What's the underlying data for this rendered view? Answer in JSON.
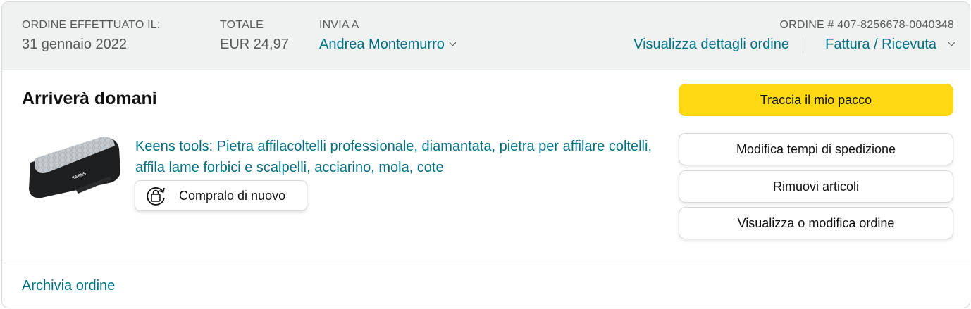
{
  "header": {
    "order_placed_label": "ORDINE EFFETTUATO IL:",
    "order_placed_value": "31 gennaio 2022",
    "total_label": "TOTALE",
    "total_value": "EUR 24,97",
    "ship_to_label": "INVIA A",
    "ship_to_value": "Andrea Montemurro",
    "order_number_label": "ORDINE # 407-8256678-0040348",
    "view_details_link": "Visualizza dettagli ordine",
    "invoice_link": "Fattura / Ricevuta"
  },
  "shipment": {
    "status_title": "Arriverà domani"
  },
  "product": {
    "title": "Keens tools: Pietra affilacoltelli professionale, diamantata, pietra per affilare coltelli, affila lame forbici e scalpelli, acciarino, mola, cote",
    "image_brand_text": "KEENS",
    "buy_again_label": "Compralo di nuovo"
  },
  "actions": {
    "track_package": "Traccia il mio pacco",
    "change_delivery": "Modifica tempi di spedizione",
    "remove_items": "Rimuovi articoli",
    "view_edit_order": "Visualizza o modifica ordine"
  },
  "footer": {
    "archive_link": "Archivia ordine"
  },
  "colors": {
    "link": "#007185",
    "header_bg": "#f0f2f2",
    "primary_button": "#ffd814",
    "border": "#d5d9d9"
  },
  "icons": [
    "chevron-down-icon",
    "buy-again-icon"
  ]
}
